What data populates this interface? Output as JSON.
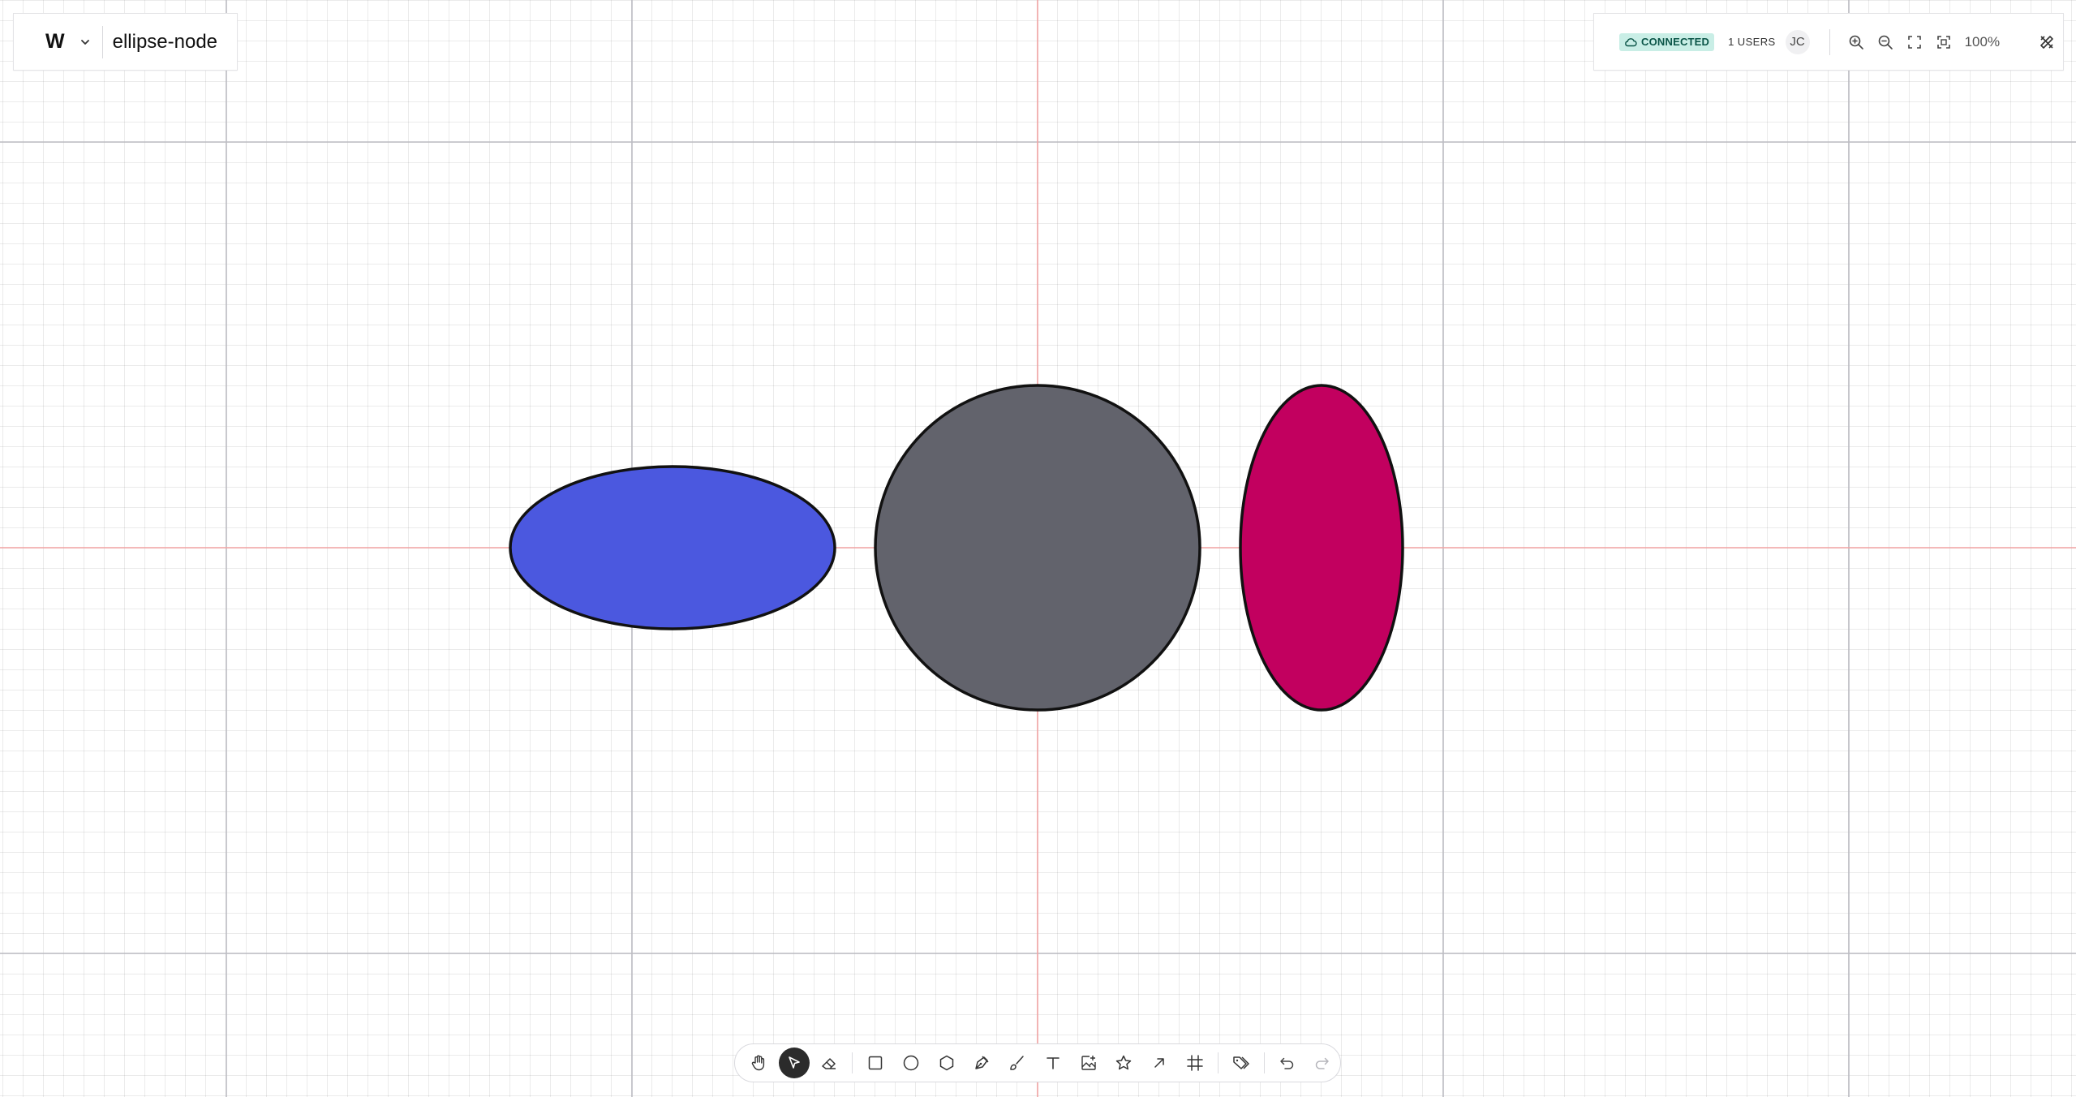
{
  "app": {
    "logo": "W",
    "document_title": "ellipse-node"
  },
  "status": {
    "connection_label": "CONNECTED",
    "users_label": "1 USERS",
    "avatar_initials": "JC",
    "zoom_level": "100%"
  },
  "canvas": {
    "shapes": [
      {
        "name": "ellipse-blue",
        "fill": "#4b58df",
        "stroke": "#111111"
      },
      {
        "name": "circle-gray",
        "fill": "#62636c",
        "stroke": "#111111"
      },
      {
        "name": "ellipse-magenta",
        "fill": "#c2005f",
        "stroke": "#111111"
      }
    ],
    "axis_color": "#f2a6a6",
    "major_grid_color": "#b8b8be"
  },
  "toolbar": {
    "tools": [
      "hand",
      "select",
      "eraser",
      "rectangle",
      "ellipse",
      "polygon",
      "pen",
      "brush",
      "text",
      "image",
      "star",
      "arrow",
      "frame",
      "tag",
      "undo",
      "redo"
    ],
    "active_tool": "select"
  }
}
